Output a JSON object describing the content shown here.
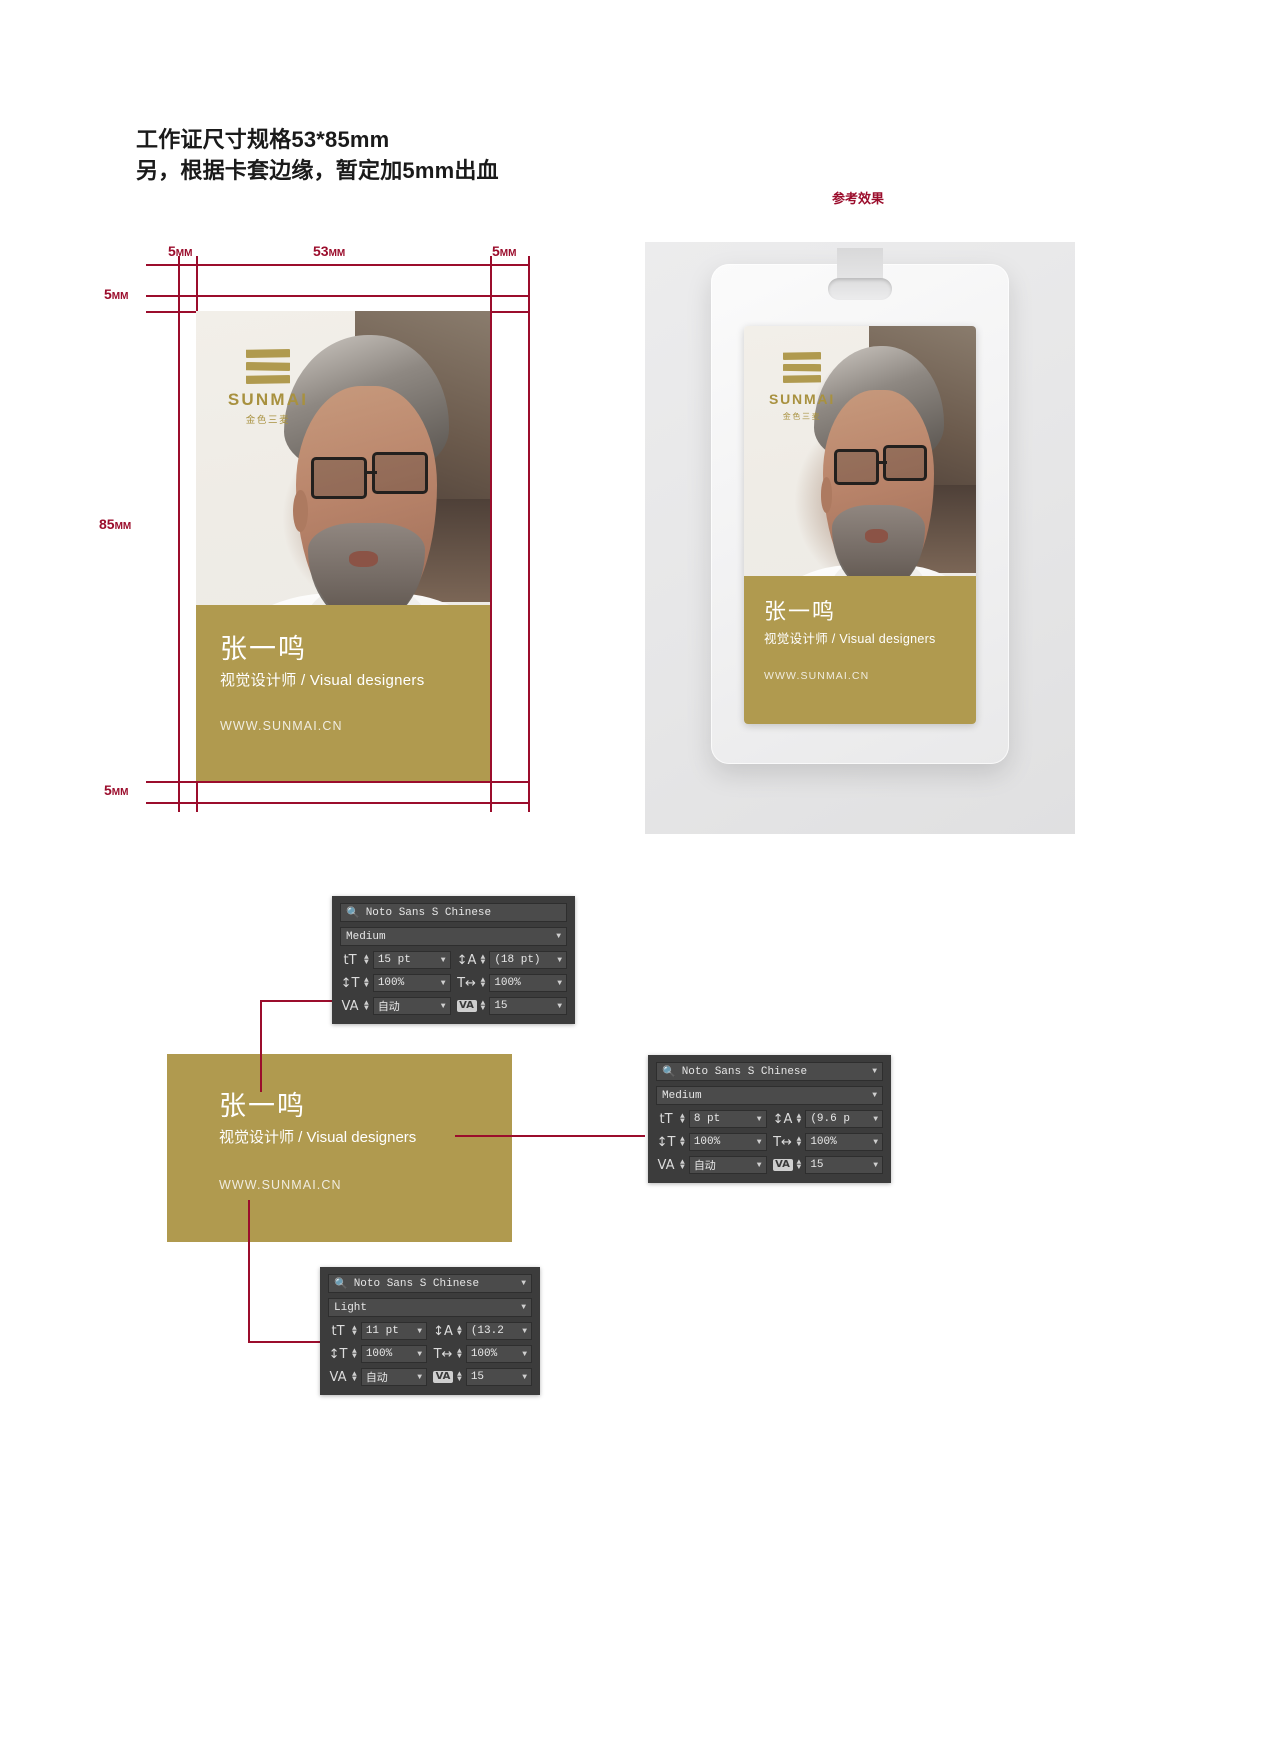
{
  "heading": {
    "line1": "工作证尺寸规格53*85mm",
    "line2": "另，根据卡套边缘，暂定加5mm出血"
  },
  "dimensions": {
    "top_left_bleed": "5",
    "top_width": "53",
    "top_right_bleed": "5",
    "left_top_bleed": "5",
    "left_height": "85",
    "left_bottom_bleed": "5",
    "unit": "MM"
  },
  "reference": {
    "title": "参考效果"
  },
  "brand": {
    "wordmark": "SUNMAI",
    "chinese": "金色三麦",
    "logo_icon": "three-bars-logo",
    "gold": "#b09a4f",
    "guide_red": "#9b0d2c"
  },
  "badge": {
    "name": "张一鸣",
    "role": "视觉设计师 / Visual designers",
    "url": "WWW.SUNMAI.CN"
  },
  "panels": [
    {
      "id": "name-type-panel",
      "font_family": "Noto Sans S Chinese",
      "font_style": "Medium",
      "size": "15 pt",
      "leading": "(18 pt)",
      "vertical_scale": "100%",
      "horizontal_scale": "100%",
      "kerning": "自动",
      "tracking": "15",
      "search_icon": "search-icon"
    },
    {
      "id": "role-type-panel",
      "font_family": "Noto Sans S Chinese",
      "font_style": "Medium",
      "size": "8 pt",
      "leading": "(9.6 p",
      "vertical_scale": "100%",
      "horizontal_scale": "100%",
      "kerning": "自动",
      "tracking": "15",
      "search_icon": "search-icon"
    },
    {
      "id": "url-type-panel",
      "font_family": "Noto Sans S Chinese",
      "font_style": "Light",
      "size": "11 pt",
      "leading": "(13.2 ",
      "vertical_scale": "100%",
      "horizontal_scale": "100%",
      "kerning": "自动",
      "tracking": "15",
      "search_icon": "search-icon"
    }
  ],
  "glyphs": {
    "size": "tT",
    "leading": "↕A",
    "v_scale": "↕T",
    "h_scale": "T↔",
    "kerning": "VA",
    "tracking": "VA"
  }
}
